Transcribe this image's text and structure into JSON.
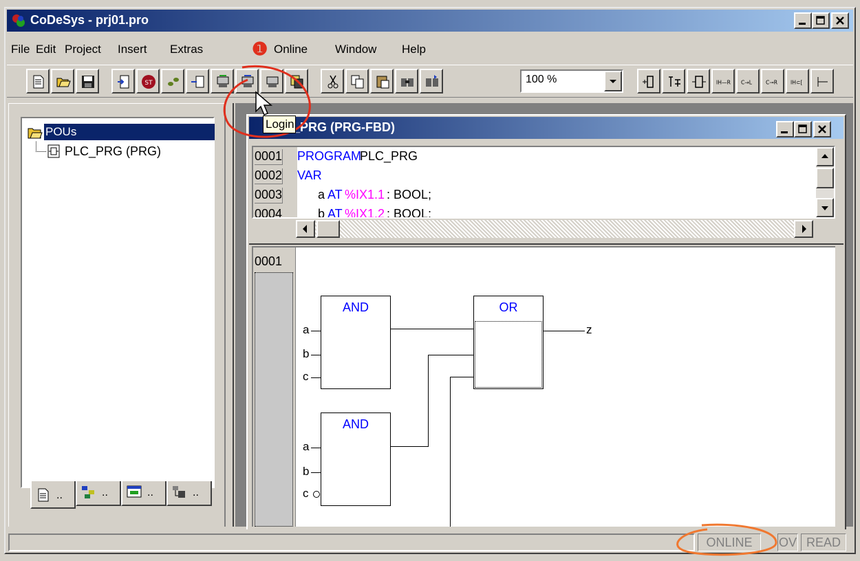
{
  "app": {
    "title": "CoDeSys - prj01.pro"
  },
  "menu": [
    "File",
    "Edit",
    "Project",
    "Insert",
    "Extras",
    "Online",
    "Window",
    "Help"
  ],
  "toolbar": {
    "zoom": "100 %",
    "tooltip": "Login"
  },
  "annotation": {
    "marker": "❶"
  },
  "tree": {
    "root": "POUs",
    "item": "PLC_PRG (PRG)"
  },
  "tabs": [
    "..",
    "..",
    "..",
    ".."
  ],
  "editor": {
    "title": "PLC_PRG (PRG-FBD)",
    "decl": [
      {
        "num": "0001",
        "parts": [
          {
            "t": "PROGRAM",
            "c": "kw-blue"
          },
          {
            "t": " PLC_PRG",
            "c": ""
          }
        ]
      },
      {
        "num": "0002",
        "parts": [
          {
            "t": "VAR",
            "c": "kw-blue"
          }
        ]
      },
      {
        "num": "0003",
        "parts": [
          {
            "t": "      a ",
            "c": ""
          },
          {
            "t": "AT",
            "c": "kw-blue"
          },
          {
            "t": " %IX1.1",
            "c": "kw-mag"
          },
          {
            "t": ": BOOL;",
            "c": ""
          }
        ]
      },
      {
        "num": "0004",
        "parts": [
          {
            "t": "      b ",
            "c": ""
          },
          {
            "t": "AT",
            "c": "kw-blue"
          },
          {
            "t": " %IX1.2",
            "c": "kw-mag"
          },
          {
            "t": ": BOOL;",
            "c": ""
          }
        ]
      }
    ],
    "network_num": "0001",
    "blocks": {
      "and1": "AND",
      "and2": "AND",
      "or": "OR"
    },
    "pins": {
      "a": "a",
      "b": "b",
      "c": "c",
      "z": "z"
    }
  },
  "status": {
    "online": "ONLINE",
    "ov": "OV",
    "read": "READ"
  },
  "colors": {
    "title_bar": "#0a246a",
    "annotation": "#e0301e",
    "status_annotation": "#f07830"
  }
}
